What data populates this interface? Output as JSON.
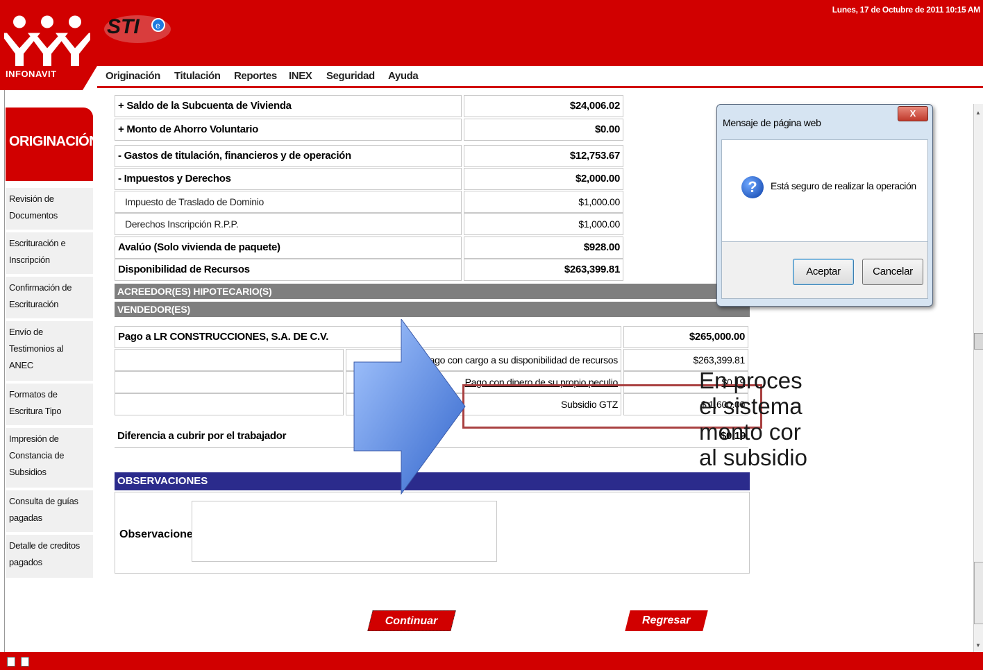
{
  "app": {
    "logo_text": "INFONAVIT",
    "sti_text": "STI",
    "datetime": "Lunes, 17 de Octubre de 2011 10:15 AM"
  },
  "menu": [
    "Originación",
    "Titulación",
    "Reportes",
    "INEX",
    "Seguridad",
    "Ayuda"
  ],
  "sidebar": {
    "title": "ORIGINACIÓN",
    "items": [
      {
        "label": "Revisión de\nDocumentos"
      },
      {
        "label": "Escrituración e\nInscripción"
      },
      {
        "label": "Confirmación de\nEscrituración"
      },
      {
        "label": "Envío de\nTestimonios al\nANEC"
      },
      {
        "label": "Formatos de\nEscritura Tipo"
      },
      {
        "label": "Impresión de\nConstancia de\nSubsidios"
      },
      {
        "label": "Consulta de guías\npagadas"
      },
      {
        "label": "Detalle de creditos\npagados"
      }
    ]
  },
  "table": {
    "rows": [
      {
        "label": "+ Saldo de la Subcuenta de Vivienda",
        "value": "$24,006.02",
        "bold": true
      },
      {
        "label": "+ Monto de Ahorro Voluntario",
        "value": "$0.00",
        "bold": true
      },
      {
        "label": "- Gastos de titulación, financieros y de operación",
        "value": "$12,753.67",
        "bold": true
      },
      {
        "label": "- Impuestos y Derechos",
        "value": "$2,000.00",
        "bold": true
      },
      {
        "label": "Impuesto de Traslado de Dominio",
        "value": "$1,000.00",
        "bold": false
      },
      {
        "label": "Derechos Inscripción R.P.P.",
        "value": "$1,000.00",
        "bold": false
      },
      {
        "label": "Avalúo (Solo vivienda de paquete)",
        "value": "$928.00",
        "bold": true
      },
      {
        "label": "Disponibilidad de Recursos",
        "value": "$263,399.81",
        "bold": true
      }
    ],
    "acreedores_header": "ACREEDOR(ES) HIPOTECARIO(S)",
    "vendedores_header": "VENDEDOR(ES)",
    "pago_label": "Pago a LR CONSTRUCCIONES, S.A. DE C.V.",
    "pago_value": "$265,000.00",
    "sub_rows": [
      {
        "label": "Pago con cargo a su disponibilidad de recursos",
        "value": "$263,399.81"
      },
      {
        "label": "Pago con dinero de su propio peculio",
        "value": "$0.19"
      },
      {
        "label": "Subsidio GTZ",
        "value": "$ 1,600.00"
      }
    ],
    "diferencia_label": "Diferencia a cubrir por el trabajador",
    "diferencia_value": "$0.19"
  },
  "observaciones": {
    "header": "OBSERVACIONES",
    "label": "Observaciones",
    "value": ""
  },
  "buttons": {
    "continuar": "Continuar",
    "regresar": "Regresar"
  },
  "dialog": {
    "title": "Mensaje de página web",
    "close": "X",
    "message": "Está seguro de realizar la operación",
    "accept": "Aceptar",
    "cancel": "Cancelar"
  },
  "caption": "En proces\nel sistema\nmonto cor\nal subsidio",
  "colors": {
    "brand_red": "#d10000",
    "section_gray": "#7f7f7f",
    "obs_header": "#2b2b8c",
    "highlight": "#a94040"
  }
}
